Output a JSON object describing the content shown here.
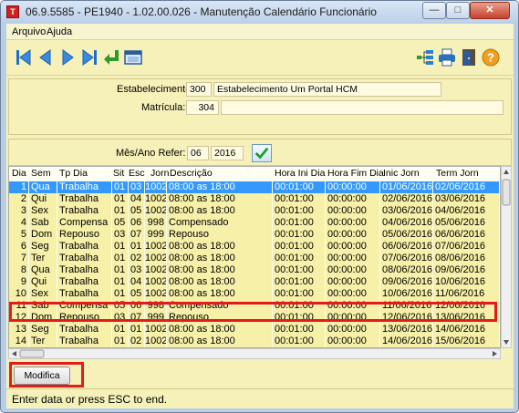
{
  "window": {
    "title": "06.9.5585 - PE1940 - 1.02.00.026 - Manutenção Calendário Funcionário",
    "app_icon_text": "T",
    "min_glyph": "—",
    "max_glyph": "□",
    "close_glyph": "✕"
  },
  "menu": {
    "items": [
      "Arquivo",
      "Ajuda"
    ]
  },
  "toolbar": {
    "nav_icons": [
      "first-record-icon",
      "previous-record-icon",
      "next-record-icon",
      "last-record-icon",
      "return-icon",
      "window-icon"
    ],
    "right_icons": [
      "tree-icon",
      "printer-icon",
      "exit-door-icon",
      "help-icon"
    ]
  },
  "form": {
    "estabelecimento_label": "Estabelecimento:",
    "estabelecimento_code": "300",
    "estabelecimento_name": "Estabelecimento Um Portal HCM",
    "matricula_label": "Matrícula:",
    "matricula_value": "304",
    "mes_ano_label": "Mês/Ano Refer:",
    "mes_value": "06",
    "ano_value": "2016"
  },
  "grid": {
    "columns": [
      "Dia",
      "Sem",
      "Tp Dia",
      "Sit",
      "Esc",
      "Jorn",
      "Descrição",
      "Hora Ini Dia",
      "Hora Fim Dia",
      "Inic  Jorn",
      "Term  Jorn"
    ],
    "rows": [
      [
        "1",
        "Qua",
        "Trabalha",
        "01",
        "03",
        "1002",
        "08:00 as 18:00",
        "00:01:00",
        "00:00:00",
        "01/06/2016",
        "02/06/2016"
      ],
      [
        "2",
        "Qui",
        "Trabalha",
        "01",
        "04",
        "1002",
        "08:00 as 18:00",
        "00:01:00",
        "00:00:00",
        "02/06/2016",
        "03/06/2016"
      ],
      [
        "3",
        "Sex",
        "Trabalha",
        "01",
        "05",
        "1002",
        "08:00 as 18:00",
        "00:01:00",
        "00:00:00",
        "03/06/2016",
        "04/06/2016"
      ],
      [
        "4",
        "Sab",
        "Compensa",
        "05",
        "06",
        "998",
        "Compensado",
        "00:01:00",
        "00:00:00",
        "04/06/2016",
        "05/06/2016"
      ],
      [
        "5",
        "Dom",
        "Repouso",
        "03",
        "07",
        "999",
        "Repouso",
        "00:01:00",
        "00:00:00",
        "05/06/2016",
        "06/06/2016"
      ],
      [
        "6",
        "Seg",
        "Trabalha",
        "01",
        "01",
        "1002",
        "08:00 as 18:00",
        "00:01:00",
        "00:00:00",
        "06/06/2016",
        "07/06/2016"
      ],
      [
        "7",
        "Ter",
        "Trabalha",
        "01",
        "02",
        "1002",
        "08:00 as 18:00",
        "00:01:00",
        "00:00:00",
        "07/06/2016",
        "08/06/2016"
      ],
      [
        "8",
        "Qua",
        "Trabalha",
        "01",
        "03",
        "1002",
        "08:00 as 18:00",
        "00:01:00",
        "00:00:00",
        "08/06/2016",
        "09/06/2016"
      ],
      [
        "9",
        "Qui",
        "Trabalha",
        "01",
        "04",
        "1002",
        "08:00 as 18:00",
        "00:01:00",
        "00:00:00",
        "09/06/2016",
        "10/06/2016"
      ],
      [
        "10",
        "Sex",
        "Trabalha",
        "01",
        "05",
        "1002",
        "08:00 as 18:00",
        "00:01:00",
        "00:00:00",
        "10/06/2016",
        "11/06/2016"
      ],
      [
        "11",
        "Sab",
        "Compensa",
        "05",
        "06",
        "998",
        "Compensado",
        "00:01:00",
        "00:00:00",
        "11/06/2016",
        "12/06/2016"
      ],
      [
        "12",
        "Dom",
        "Repouso",
        "03",
        "07",
        "999",
        "Repouso",
        "00:01:00",
        "00:00:00",
        "12/06/2016",
        "13/06/2016"
      ],
      [
        "13",
        "Seg",
        "Trabalha",
        "01",
        "01",
        "1002",
        "08:00 as 18:00",
        "00:01:00",
        "00:00:00",
        "13/06/2016",
        "14/06/2016"
      ],
      [
        "14",
        "Ter",
        "Trabalha",
        "01",
        "02",
        "1002",
        "08:00 as 18:00",
        "00:01:00",
        "00:00:00",
        "14/06/2016",
        "15/06/2016"
      ]
    ],
    "selected_row": 0,
    "highlighted_row": 11
  },
  "buttons": {
    "modifica": "Modifica"
  },
  "status": {
    "text": "Enter data or press ESC to end."
  },
  "colors": {
    "highlight": "#e41b1b",
    "selection": "#3399ff",
    "panel": "#f6f1b9",
    "row": "#f6f0a8"
  }
}
